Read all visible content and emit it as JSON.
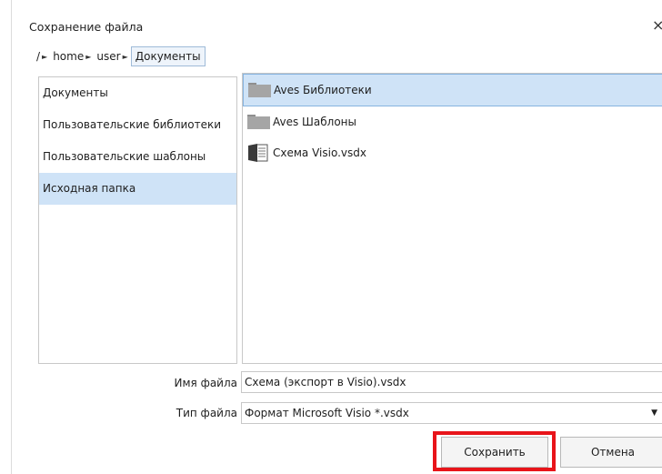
{
  "dialog": {
    "title": "Сохранение файла",
    "close_glyph": "×"
  },
  "breadcrumb": [
    {
      "label": "/",
      "arrow": true
    },
    {
      "label": "home",
      "arrow": true
    },
    {
      "label": "user",
      "arrow": true
    },
    {
      "label": "Документы",
      "arrow": false,
      "current": true
    }
  ],
  "places": [
    {
      "label": "Документы",
      "selected": false
    },
    {
      "label": "Пользовательские библиотеки",
      "selected": false
    },
    {
      "label": "Пользовательские шаблоны",
      "selected": false
    },
    {
      "label": "Исходная папка",
      "selected": true
    }
  ],
  "files": [
    {
      "name": "Aves Библиотеки",
      "icon": "folder-icon",
      "selected": true
    },
    {
      "name": "Aves Шаблоны",
      "icon": "folder-icon",
      "selected": false
    },
    {
      "name": "Схема Visio.vsdx",
      "icon": "visio-document-icon",
      "selected": false
    }
  ],
  "form": {
    "filename_label": "Имя файла",
    "filename_value": "Схема (экспорт в Visio).vsdx",
    "filetype_label": "Тип файла",
    "filetype_value": "Формат Microsoft Visio *.vsdx"
  },
  "buttons": {
    "save": "Сохранить",
    "cancel": "Отмена"
  },
  "colors": {
    "selection": "#cfe3f7",
    "highlight": "#e8141a"
  }
}
